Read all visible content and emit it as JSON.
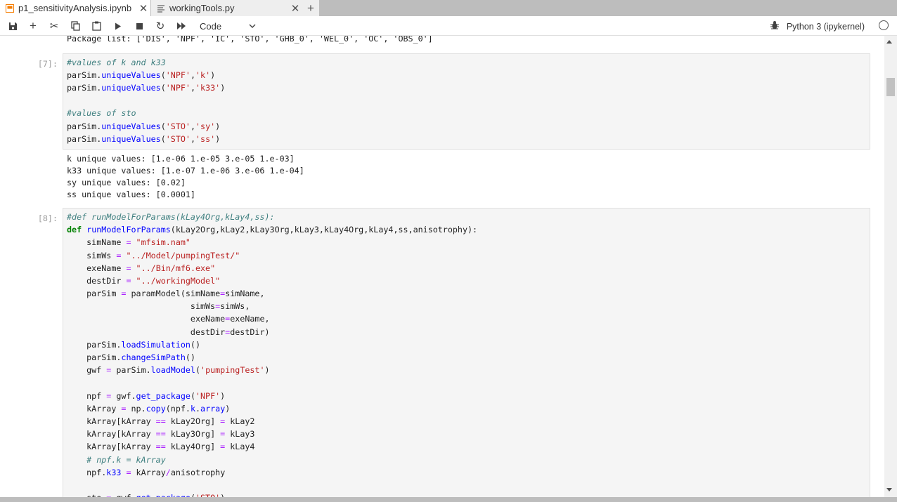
{
  "tabs": [
    {
      "label": "p1_sensitivityAnalysis.ipynb",
      "icon": "notebook-icon",
      "active": true
    },
    {
      "label": "workingTools.py",
      "icon": "text-file-icon",
      "active": false
    }
  ],
  "toolbar": {
    "cell_type": "Code",
    "kernel_name": "Python 3 (ipykernel)"
  },
  "colors": {
    "accent": "#f57c00",
    "comment": "#408080",
    "keyword": "#008000",
    "string": "#ba2121",
    "function": "#0000ff",
    "operator": "#aa22ff"
  },
  "top_output": "Package list: ['DIS', 'NPF', 'IC', 'STO', 'GHB_0', 'WEL_0', 'OC', 'OBS_0']",
  "cell7": {
    "prompt": "[7]:",
    "output": [
      "k unique values: [1.e-06 1.e-05 3.e-05 1.e-03]",
      "k33 unique values: [1.e-07 1.e-06 3.e-06 1.e-04]",
      "sy unique values: [0.02]",
      "ss unique values: [0.0001]"
    ]
  },
  "cell8": {
    "prompt": "[8]:"
  }
}
